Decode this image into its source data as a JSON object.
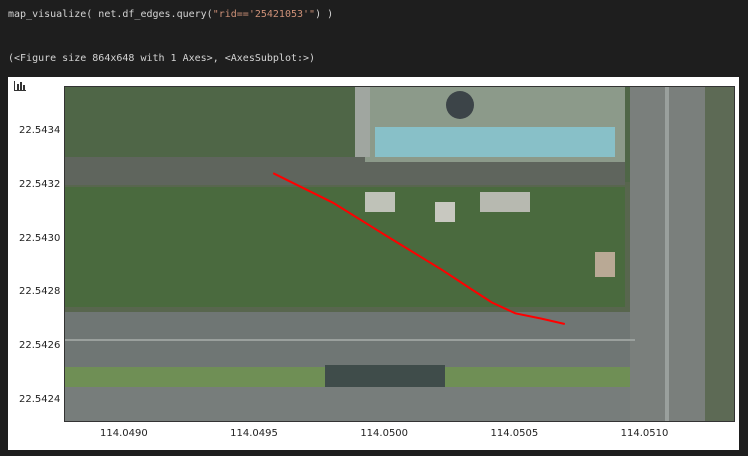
{
  "cell": {
    "code_prefix": "map_visualize( net.df_edges.query(",
    "code_string": "\"rid=='25421053'\"",
    "code_suffix": ") )",
    "output": "(<Figure size 864x648 with 1 Axes>, <AxesSubplot:>)"
  },
  "figure": {
    "toolbar_icon": "bar-chart-icon",
    "colors": {
      "route": "#ff0000",
      "panel": "#ffffff",
      "background": "#1e1e1e"
    }
  },
  "chart_data": {
    "type": "line",
    "title": "",
    "xlabel": "",
    "ylabel": "",
    "xlim": [
      114.04877,
      114.05134
    ],
    "ylim": [
      22.54233,
      22.54357
    ],
    "xticks": [
      "114.0490",
      "114.0495",
      "114.0500",
      "114.0505",
      "114.0510"
    ],
    "xtick_values": [
      114.049,
      114.0495,
      114.05,
      114.0505,
      114.051
    ],
    "yticks": [
      "22.5424",
      "22.5426",
      "22.5428",
      "22.5430",
      "22.5432",
      "22.5434"
    ],
    "ytick_values": [
      22.5424,
      22.5426,
      22.5428,
      22.543,
      22.5432,
      22.5434
    ],
    "grid": false,
    "series": [
      {
        "x": [
          114.04957,
          114.0498,
          114.05,
          114.05022,
          114.05033,
          114.05041,
          114.0505,
          114.0506,
          114.05069
        ],
        "y": [
          22.54325,
          22.54314,
          22.54302,
          22.54289,
          22.54282,
          22.54277,
          22.54273,
          22.54271,
          22.54269
        ],
        "color": "#ff0000"
      }
    ]
  }
}
